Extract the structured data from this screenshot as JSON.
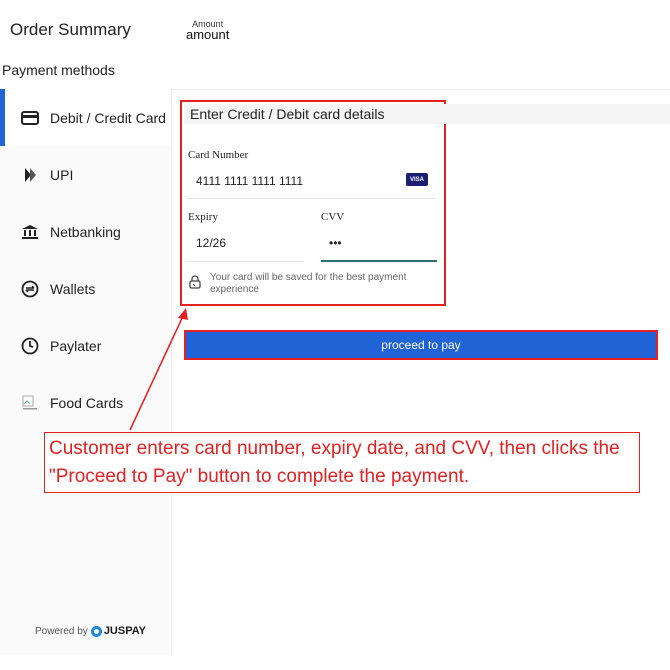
{
  "header": {
    "title": "Order Summary",
    "amount_label": "Amount",
    "amount_value": "amount"
  },
  "payment_methods_heading": "Payment methods",
  "sidebar": {
    "items": [
      {
        "label": "Debit / Credit Card",
        "icon": "card-icon",
        "active": true
      },
      {
        "label": "UPI",
        "icon": "upi-icon",
        "active": false
      },
      {
        "label": "Netbanking",
        "icon": "bank-icon",
        "active": false
      },
      {
        "label": "Wallets",
        "icon": "wallet-icon",
        "active": false
      },
      {
        "label": "Paylater",
        "icon": "paylater-icon",
        "active": false
      },
      {
        "label": "Food Cards",
        "icon": "food-card-image-icon",
        "active": false
      }
    ],
    "powered_by": "Powered by",
    "brand": "JUSPAY"
  },
  "card_form": {
    "title": "Enter Credit / Debit card details",
    "card_number_label": "Card Number",
    "card_number_value": "4111 1111 1111 1111",
    "card_brand": "VISA",
    "expiry_label": "Expiry",
    "expiry_value": "12/26",
    "cvv_label": "CVV",
    "cvv_value": "•••",
    "save_note": "Your card will be saved for the best payment experience"
  },
  "pay_button": {
    "label": "proceed to pay"
  },
  "annotation": {
    "text": "Customer enters card number, expiry date, and CVV, then clicks the \"Proceed to Pay\" button to complete the payment."
  },
  "colors": {
    "accent": "#1f63d6",
    "highlight": "#e52020"
  }
}
